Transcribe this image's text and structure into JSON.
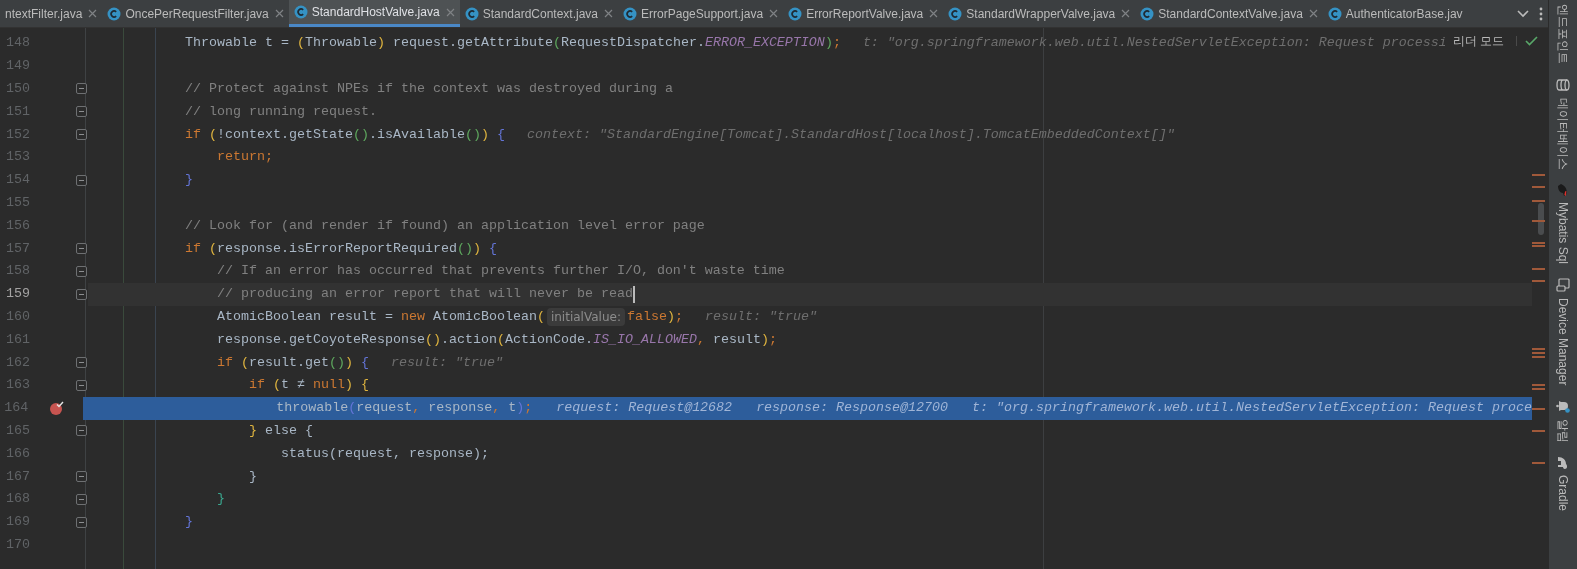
{
  "tabs": [
    {
      "label": "ntextFilter.java",
      "selected": false,
      "icon": false
    },
    {
      "label": "OncePerRequestFilter.java",
      "selected": false,
      "icon": true
    },
    {
      "label": "StandardHostValve.java",
      "selected": true,
      "icon": true
    },
    {
      "label": "StandardContext.java",
      "selected": false,
      "icon": true
    },
    {
      "label": "ErrorPageSupport.java",
      "selected": false,
      "icon": true
    },
    {
      "label": "ErrorReportValve.java",
      "selected": false,
      "icon": true
    },
    {
      "label": "StandardWrapperValve.java",
      "selected": false,
      "icon": true
    },
    {
      "label": "StandardContextValve.java",
      "selected": false,
      "icon": true
    },
    {
      "label": "AuthenticatorBase.jav",
      "selected": false,
      "icon": true
    }
  ],
  "reader_mode": "리더 모드",
  "lines": [
    {
      "number": "148",
      "fold": false,
      "breakpoint": false,
      "execution": false,
      "current": false,
      "tokens": [
        {
          "kind": "text",
          "text": "        Throwable t = "
        },
        {
          "kind": "b1",
          "text": "("
        },
        {
          "kind": "text",
          "text": "Throwable"
        },
        {
          "kind": "b1",
          "text": ")"
        },
        {
          "kind": "text",
          "text": " request.getAttribute"
        },
        {
          "kind": "b2",
          "text": "("
        },
        {
          "kind": "text",
          "text": "RequestDispatcher."
        },
        {
          "kind": "constant",
          "text": "ERROR_EXCEPTION"
        },
        {
          "kind": "b2",
          "text": ")"
        },
        {
          "kind": "keyword",
          "text": ";"
        }
      ],
      "hints": [
        {
          "label": "t:",
          "value": "\"org.springframework.web.util.NestedServletException: Request processi"
        }
      ]
    },
    {
      "number": "149",
      "fold": false,
      "breakpoint": false,
      "execution": false,
      "current": false
    },
    {
      "number": "150",
      "fold": true,
      "breakpoint": false,
      "execution": false,
      "current": false,
      "tokens": [
        {
          "kind": "comment",
          "text": "        // Protect against NPEs if the context was destroyed during a"
        }
      ]
    },
    {
      "number": "151",
      "fold": true,
      "breakpoint": false,
      "execution": false,
      "current": false,
      "tokens": [
        {
          "kind": "comment",
          "text": "        // long running request."
        }
      ]
    },
    {
      "number": "152",
      "fold": true,
      "breakpoint": false,
      "execution": false,
      "current": false,
      "tokens": [
        {
          "kind": "keyword",
          "text": "        if "
        },
        {
          "kind": "b1",
          "text": "("
        },
        {
          "kind": "text",
          "text": "!context.getState"
        },
        {
          "kind": "b2",
          "text": "()"
        },
        {
          "kind": "text",
          "text": ".isAvailable"
        },
        {
          "kind": "b2",
          "text": "()"
        },
        {
          "kind": "b1",
          "text": ") "
        },
        {
          "kind": "b3",
          "text": "{"
        }
      ],
      "hints": [
        {
          "label": "context:",
          "value": "\"StandardEngine[Tomcat].StandardHost[localhost].TomcatEmbeddedContext[]\""
        }
      ]
    },
    {
      "number": "153",
      "fold": false,
      "breakpoint": false,
      "execution": false,
      "current": false,
      "tokens": [
        {
          "kind": "keyword",
          "text": "            return;"
        }
      ]
    },
    {
      "number": "154",
      "fold": true,
      "breakpoint": false,
      "execution": false,
      "current": false,
      "tokens": [
        {
          "kind": "b3",
          "text": "        }"
        }
      ]
    },
    {
      "number": "155",
      "fold": false,
      "breakpoint": false,
      "execution": false,
      "current": false
    },
    {
      "number": "156",
      "fold": false,
      "breakpoint": false,
      "execution": false,
      "current": false,
      "tokens": [
        {
          "kind": "comment",
          "text": "        // Look for (and render if found) an application level error page"
        }
      ]
    },
    {
      "number": "157",
      "fold": true,
      "breakpoint": false,
      "execution": false,
      "current": false,
      "tokens": [
        {
          "kind": "keyword",
          "text": "        if "
        },
        {
          "kind": "b1",
          "text": "("
        },
        {
          "kind": "text",
          "text": "response.isErrorReportRequired"
        },
        {
          "kind": "b2",
          "text": "()"
        },
        {
          "kind": "b1",
          "text": ") "
        },
        {
          "kind": "b3",
          "text": "{"
        }
      ]
    },
    {
      "number": "158",
      "fold": true,
      "breakpoint": false,
      "execution": false,
      "current": false,
      "tokens": [
        {
          "kind": "comment",
          "text": "            // If an error has occurred that prevents further I/O, don't waste time"
        }
      ]
    },
    {
      "number": "159",
      "fold": true,
      "breakpoint": false,
      "execution": false,
      "current": true,
      "tokens": [
        {
          "kind": "comment",
          "text": "            // producing an error report that will never be read"
        }
      ]
    },
    {
      "number": "160",
      "fold": false,
      "breakpoint": false,
      "execution": false,
      "current": false,
      "tokens": [
        {
          "kind": "text",
          "text": "            AtomicBoolean result = "
        },
        {
          "kind": "keyword",
          "text": "new"
        },
        {
          "kind": "text",
          "text": " AtomicBoolean"
        },
        {
          "kind": "b1",
          "text": "("
        },
        {
          "kind": "inlay",
          "text": "initialValue:"
        },
        {
          "kind": "keyword",
          "text": "false"
        },
        {
          "kind": "b1",
          "text": ")"
        },
        {
          "kind": "keyword",
          "text": ";"
        }
      ],
      "hints": [
        {
          "label": "result:",
          "value": "\"true\""
        }
      ]
    },
    {
      "number": "161",
      "fold": false,
      "breakpoint": false,
      "execution": false,
      "current": false,
      "tokens": [
        {
          "kind": "text",
          "text": "            response.getCoyoteResponse"
        },
        {
          "kind": "b1",
          "text": "()"
        },
        {
          "kind": "text",
          "text": ".action"
        },
        {
          "kind": "b1",
          "text": "("
        },
        {
          "kind": "text",
          "text": "ActionCode."
        },
        {
          "kind": "constant",
          "text": "IS_IO_ALLOWED"
        },
        {
          "kind": "keyword",
          "text": ","
        },
        {
          "kind": "text",
          "text": " result"
        },
        {
          "kind": "b1",
          "text": ")"
        },
        {
          "kind": "keyword",
          "text": ";"
        }
      ]
    },
    {
      "number": "162",
      "fold": true,
      "breakpoint": false,
      "execution": false,
      "current": false,
      "tokens": [
        {
          "kind": "keyword",
          "text": "            if "
        },
        {
          "kind": "b1",
          "text": "("
        },
        {
          "kind": "text",
          "text": "result.get"
        },
        {
          "kind": "b2",
          "text": "()"
        },
        {
          "kind": "b1",
          "text": ") "
        },
        {
          "kind": "b3",
          "text": "{"
        }
      ],
      "hints": [
        {
          "label": "result:",
          "value": "\"true\""
        }
      ]
    },
    {
      "number": "163",
      "fold": true,
      "breakpoint": false,
      "execution": false,
      "current": false,
      "tokens": [
        {
          "kind": "keyword",
          "text": "                if "
        },
        {
          "kind": "b1",
          "text": "("
        },
        {
          "kind": "text",
          "text": "t ≠ "
        },
        {
          "kind": "keyword",
          "text": "null"
        },
        {
          "kind": "b1",
          "text": ") {"
        }
      ]
    },
    {
      "number": "164",
      "fold": false,
      "breakpoint": true,
      "execution": true,
      "current": false,
      "tokens": [
        {
          "kind": "text",
          "text": "                    throwable"
        },
        {
          "kind": "b3",
          "text": "("
        },
        {
          "kind": "text",
          "text": "request"
        },
        {
          "kind": "keyword",
          "text": ", "
        },
        {
          "kind": "text",
          "text": "response"
        },
        {
          "kind": "keyword",
          "text": ", "
        },
        {
          "kind": "text",
          "text": "t"
        },
        {
          "kind": "b3",
          "text": ")"
        },
        {
          "kind": "keyword",
          "text": ";"
        }
      ],
      "hints": [
        {
          "label": "request:",
          "value": "Request@12682"
        },
        {
          "label": "response:",
          "value": "Response@12700"
        },
        {
          "label": "t:",
          "value": "\"org.springframework.web.util.NestedServletException: Request proce"
        }
      ]
    },
    {
      "number": "165",
      "fold": true,
      "breakpoint": false,
      "execution": false,
      "current": false,
      "tokens": [
        {
          "kind": "b1",
          "text": "                }"
        },
        {
          "kind": "text",
          "text": " else {"
        }
      ]
    },
    {
      "number": "166",
      "fold": false,
      "breakpoint": false,
      "execution": false,
      "current": false,
      "tokens": [
        {
          "kind": "text",
          "text": "                    status(request, response);"
        }
      ]
    },
    {
      "number": "167",
      "fold": true,
      "breakpoint": false,
      "execution": false,
      "current": false,
      "tokens": [
        {
          "kind": "text",
          "text": "                }"
        }
      ]
    },
    {
      "number": "168",
      "fold": true,
      "breakpoint": false,
      "execution": false,
      "current": false,
      "tokens": [
        {
          "kind": "b4",
          "text": "            }"
        }
      ]
    },
    {
      "number": "169",
      "fold": true,
      "breakpoint": false,
      "execution": false,
      "current": false,
      "tokens": [
        {
          "kind": "b3",
          "text": "        }"
        }
      ]
    },
    {
      "number": "170",
      "fold": false,
      "breakpoint": false,
      "execution": false,
      "current": false
    }
  ],
  "sidebar": {
    "items": [
      {
        "label": "엔드포인트"
      },
      {
        "label": "데이터베이스"
      },
      {
        "label": "Mybatis Sql"
      },
      {
        "label": "Device Manager"
      },
      {
        "label": "알림"
      },
      {
        "label": "Gradle"
      }
    ]
  }
}
